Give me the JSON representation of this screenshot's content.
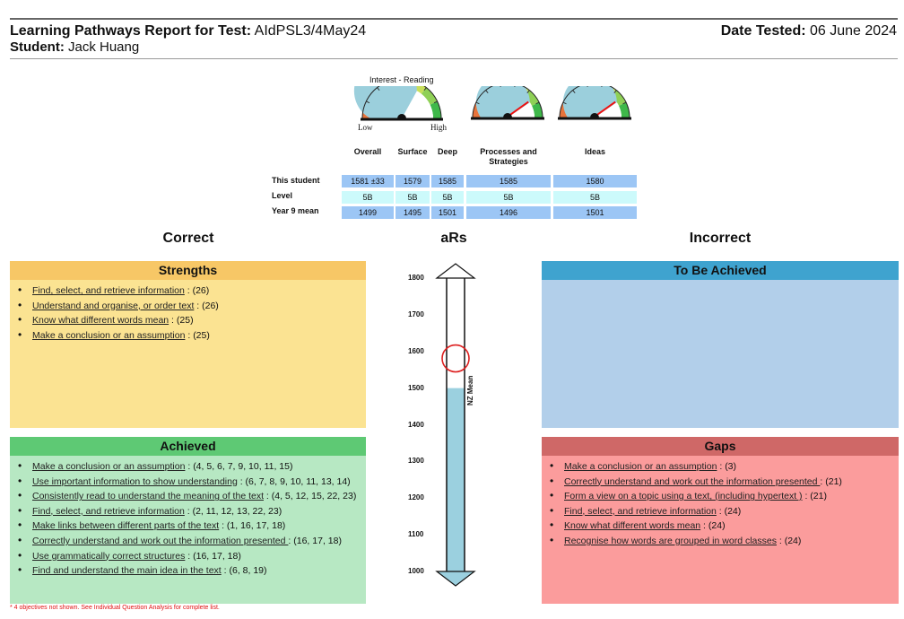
{
  "header": {
    "title_label": "Learning Pathways Report for Test:",
    "test_name": "AIdPSL3/4May24",
    "student_label": "Student:",
    "student_name": "Jack Huang",
    "date_label": "Date Tested:",
    "date_value": "06 June 2024"
  },
  "gauges": {
    "caption": "Interest - Reading",
    "low_label": "Low",
    "high_label": "High",
    "items": [
      {
        "name": "Interest - Reading",
        "level_fraction": 0.66,
        "needle": false
      },
      {
        "name": "Processes and Strategies",
        "level_fraction": 0.81,
        "needle": true
      },
      {
        "name": "Ideas",
        "level_fraction": 0.81,
        "needle": true
      }
    ],
    "needle_color": "#ee1111"
  },
  "scores": {
    "columns": [
      "Overall",
      "Surface",
      "Deep",
      "Processes and Strategies",
      "Ideas"
    ],
    "rows": [
      {
        "label": "This student",
        "values": [
          "1581 ±33",
          "1579",
          "1585",
          "1585",
          "1580"
        ]
      },
      {
        "label": "Level",
        "values": [
          "5B",
          "5B",
          "5B",
          "5B",
          "5B"
        ]
      },
      {
        "label": "Year 9 mean",
        "values": [
          "1499",
          "1495",
          "1501",
          "1496",
          "1501"
        ]
      }
    ]
  },
  "sections": {
    "correct": "Correct",
    "ars": "aRs",
    "incorrect": "Incorrect"
  },
  "ars_scale": {
    "ticks": [
      "1800",
      "1700",
      "1600",
      "1500",
      "1400",
      "1300",
      "1200",
      "1100",
      "1000"
    ],
    "min": 1000,
    "max": 1800,
    "nz_mean": 1500,
    "nz_mean_label": "NZ Mean",
    "student_score": 1581,
    "fill_color": "#9bd0df",
    "marker_color": "#dd2020"
  },
  "panels": {
    "strengths": {
      "title": "Strengths",
      "items": [
        {
          "objective": "Find, select, and retrieve information",
          "questions": " : (26)"
        },
        {
          "objective": "Understand and organise, or order text",
          "questions": " : (26)"
        },
        {
          "objective": "Know what different words mean",
          "questions": " : (25)"
        },
        {
          "objective": "Make a conclusion or an assumption",
          "questions": " : (25)"
        }
      ]
    },
    "achieved": {
      "title": "Achieved",
      "items": [
        {
          "objective": "Make a conclusion or an assumption",
          "questions": " : (4, 5, 6, 7, 9, 10, 11, 15)"
        },
        {
          "objective": "Use important information to show understanding",
          "questions": " : (6, 7, 8, 9, 10, 11, 13, 14)"
        },
        {
          "objective": "Consistently read to understand the meaning of the text",
          "questions": " : (4, 5, 12, 15, 22, 23)"
        },
        {
          "objective": "Find, select, and retrieve information",
          "questions": " : (2, 11, 12, 13, 22, 23)"
        },
        {
          "objective": "Make links between different parts of the text",
          "questions": " : (1, 16, 17, 18)"
        },
        {
          "objective": "Correctly understand and work out the information presented ",
          "questions": " : (16, 17, 18)"
        },
        {
          "objective": "Use grammatically correct structures",
          "questions": " : (16, 17, 18)"
        },
        {
          "objective": "Find and understand the main idea in the text",
          "questions": " : (6, 8, 19)"
        }
      ]
    },
    "to_be_achieved": {
      "title": "To Be Achieved",
      "items": []
    },
    "gaps": {
      "title": "Gaps",
      "items": [
        {
          "objective": "Make a conclusion or an assumption",
          "questions": " : (3)"
        },
        {
          "objective": "Correctly understand and work out the information presented ",
          "questions": " : (21)"
        },
        {
          "objective": "Form a view on a topic using a text, (including hypertext )",
          "questions": " : (21)"
        },
        {
          "objective": "Find, select, and retrieve information",
          "questions": " : (24)"
        },
        {
          "objective": "Know what different words mean",
          "questions": " : (24)"
        },
        {
          "objective": "Recognise how words are grouped in word classes",
          "questions": " : (24)"
        }
      ]
    }
  },
  "footnote": "* 4 objectives not shown. See Individual Question Analysis for complete list."
}
